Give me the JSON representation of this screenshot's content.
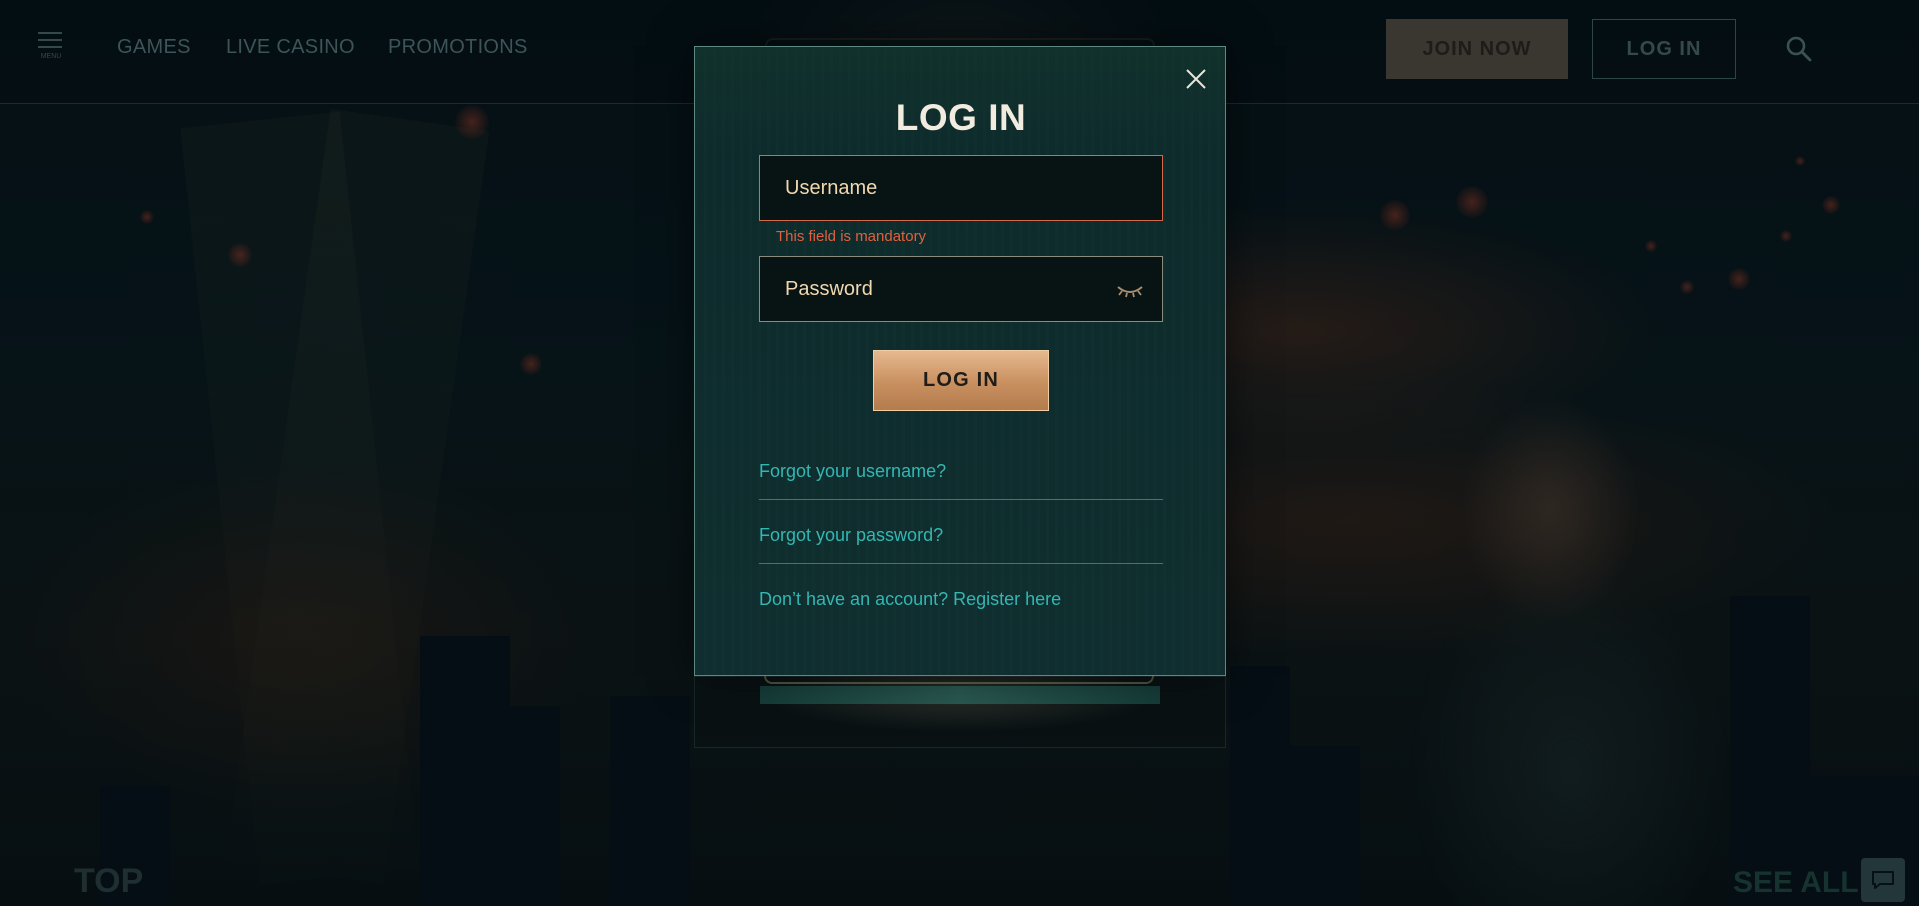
{
  "nav": {
    "menu_label": "MENU",
    "links": [
      {
        "label": "GAMES"
      },
      {
        "label": "LIVE CASINO"
      },
      {
        "label": "PROMOTIONS"
      }
    ],
    "join_label": "JOIN NOW",
    "login_label": "LOG IN",
    "search_icon": "search-icon"
  },
  "modal": {
    "title": "LOG IN",
    "username": {
      "placeholder": "Username",
      "value": "",
      "error": "This field is mandatory"
    },
    "password": {
      "placeholder": "Password",
      "value": ""
    },
    "submit_label": "LOG IN",
    "links": {
      "forgot_username": "Forgot your username?",
      "forgot_password": "Forgot your password?",
      "register": "Don’t have an account? Register here"
    }
  },
  "background": {
    "section_title": "TOP",
    "see_all": "SEE ALL"
  },
  "colors": {
    "accent_teal": "#33b7b3",
    "error_red": "#e0603f",
    "button_gold": "#c88f5f",
    "modal_bg": "#0f2c2d"
  }
}
